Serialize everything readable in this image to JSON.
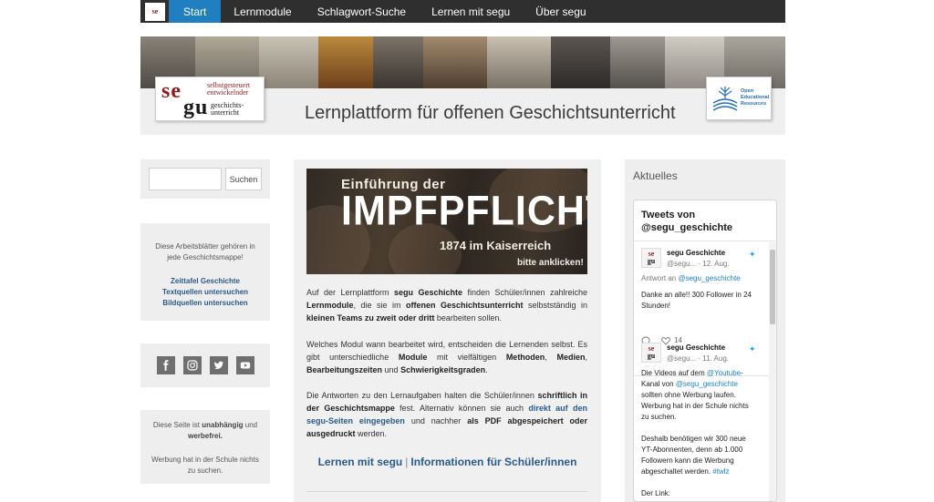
{
  "nav": {
    "logo": [
      "se",
      "gu"
    ],
    "items": [
      {
        "label": "Start",
        "active": true
      },
      {
        "label": "Lernmodule"
      },
      {
        "label": "Schlagwort-Suche"
      },
      {
        "label": "Lernen mit segu"
      },
      {
        "label": "Über segu"
      }
    ]
  },
  "banner": {
    "title": "Lernplattform für offenen Geschichtsunterricht",
    "logo": {
      "se": "se",
      "gu": "gu",
      "line1": "selbstgesteuert entwickelnder",
      "line2": "geschichts- unterricht"
    },
    "oer": "Open Educational Resources"
  },
  "sidebar": {
    "search_button": "Suchen",
    "sheets_intro": "Diese Arbeitsblätter gehören in jede Geschichtsmappe!",
    "sheets_links": [
      "Zeittafel Geschichte",
      "Textquellen untersuchen",
      "Bildquellen untersuchen"
    ],
    "social": [
      "facebook-icon",
      "instagram-icon",
      "twitter-icon",
      "youtube-icon"
    ],
    "indep_a": "Diese Seite ist",
    "indep_b1": "unabhängig",
    "indep_c": "und",
    "indep_b2": "werbefrei.",
    "indep_2": "Werbung hat in der Schule nichts zu suchen."
  },
  "main": {
    "hero": {
      "line1": "Einführung der",
      "line2": "IMPFPFLICHT",
      "line3": "1874 im Kaiserreich",
      "line4": "bitte anklicken!"
    },
    "p1": [
      "Auf der Lernplattform ",
      "segu Geschichte",
      " finden Schüler/innen zahlreiche ",
      "Lernmodule",
      ", die sie im ",
      "offenen Geschichtsunterricht",
      " selbstständig in ",
      "kleinen Teams zu zweit oder dritt",
      " bearbeiten sollen."
    ],
    "p2": [
      "Welches Modul wann bearbeitet wird, entscheiden die Lernenden selbst. Es gibt unterschiedliche ",
      "Module",
      " mit vielfältigen ",
      "Methoden",
      ", ",
      "Medien",
      ", ",
      "Bearbeitungszeiten",
      " und ",
      "Schwierigkeitsgraden",
      "."
    ],
    "p3": [
      "Die Antworten zu den Lernaufgaben halten die Schüler/innen ",
      "schriftlich in der Geschichtsmappe",
      " fest. Alternativ können sie auch ",
      "direkt auf den segu-Seiten eingegeben",
      " und nachher ",
      "als PDF abgespeichert oder ausgedruckt",
      " werden."
    ],
    "link1": "Lernen mit segu",
    "sep": "|",
    "link2": "Informationen für Schüler/innen"
  },
  "aktuelles": {
    "heading": "Aktuelles",
    "widget_title": "Tweets von @segu_geschichte",
    "tweets": [
      {
        "name": "segu Geschichte",
        "handle": "@segu... · 12. Aug.",
        "reply_prefix": "Antwort an ",
        "reply_to": "@segu_geschichte",
        "text": "Danke an alle!! 300 Follower in 24 Stunden!",
        "likes": "14"
      },
      {
        "name": "segu Geschichte",
        "handle": "@segu... · 11. Aug.",
        "t1": "Die Videos auf dem ",
        "t1_link": "@Youtube",
        "t1b": "-Kanal von ",
        "t1_link2": "@segu_geschichte",
        "t1c": " sollten ohne Werbung laufen. Werbung hat in der Schule nichts zu suchen.",
        "t2": "Deshalb benötigen wir 300 neue YT-Abonnenten, denn ab 1.000 Followern kann die Werbung abgeschaltet werden. ",
        "t2_tag": "#twlz",
        "t3": "Der Link:"
      }
    ]
  }
}
